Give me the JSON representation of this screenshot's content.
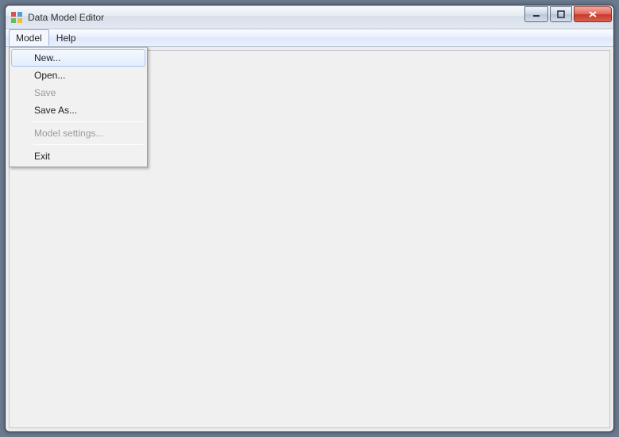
{
  "window": {
    "title": "Data Model Editor"
  },
  "menubar": {
    "items": [
      {
        "label": "Model",
        "open": true
      },
      {
        "label": "Help",
        "open": false
      }
    ]
  },
  "dropdown": {
    "items": [
      {
        "label": "New...",
        "enabled": true,
        "highlight": true
      },
      {
        "label": "Open...",
        "enabled": true,
        "highlight": false
      },
      {
        "label": "Save",
        "enabled": false,
        "highlight": false
      },
      {
        "label": "Save As...",
        "enabled": true,
        "highlight": false
      },
      {
        "sep": true
      },
      {
        "label": "Model settings...",
        "enabled": false,
        "highlight": false
      },
      {
        "sep": true
      },
      {
        "label": "Exit",
        "enabled": true,
        "highlight": false
      }
    ]
  }
}
